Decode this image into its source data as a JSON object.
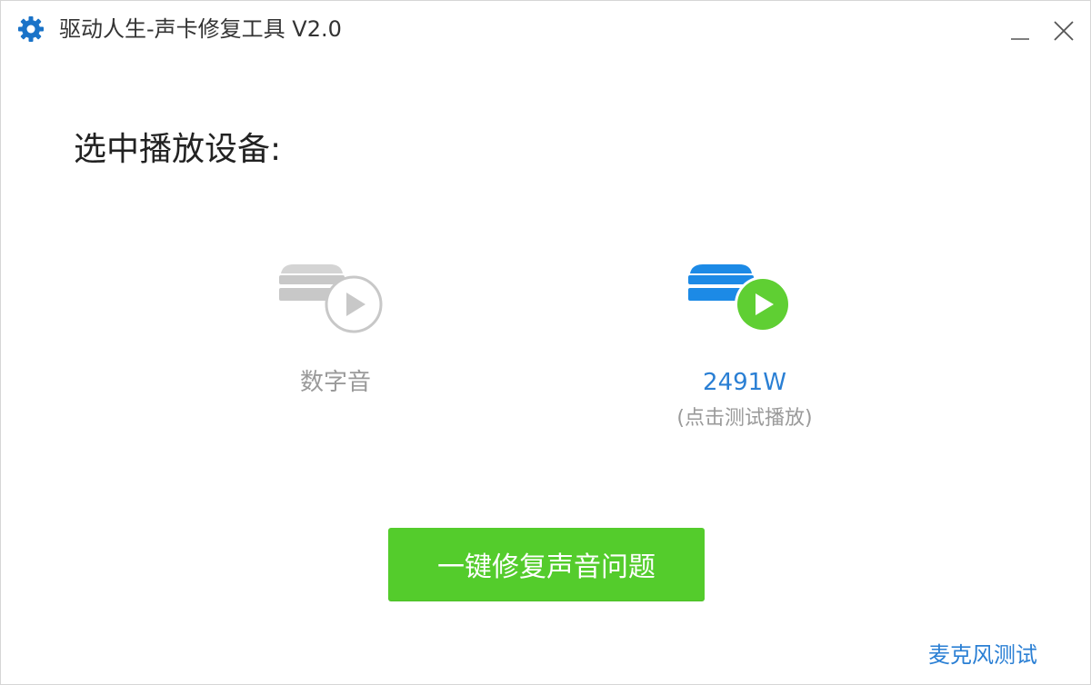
{
  "window": {
    "title": "驱动人生-声卡修复工具 V2.0"
  },
  "heading": "选中播放设备:",
  "devices": [
    {
      "name": "数字音",
      "hint": "",
      "state": "inactive",
      "icon": "speaker-device-icon"
    },
    {
      "name": "2491W",
      "hint": "(点击测试播放)",
      "state": "active",
      "icon": "speaker-device-icon"
    }
  ],
  "fix_button": {
    "label": "一键修复声音问题"
  },
  "mic_test_link": "麦克风测试",
  "colors": {
    "accent_green": "#54cc2c",
    "link_blue": "#2a7fd4",
    "device_active_blue": "#1c8ae6",
    "play_green": "#5fcf33",
    "inactive_gray": "#c8c8c8",
    "app_icon_blue": "#1a73c8"
  }
}
